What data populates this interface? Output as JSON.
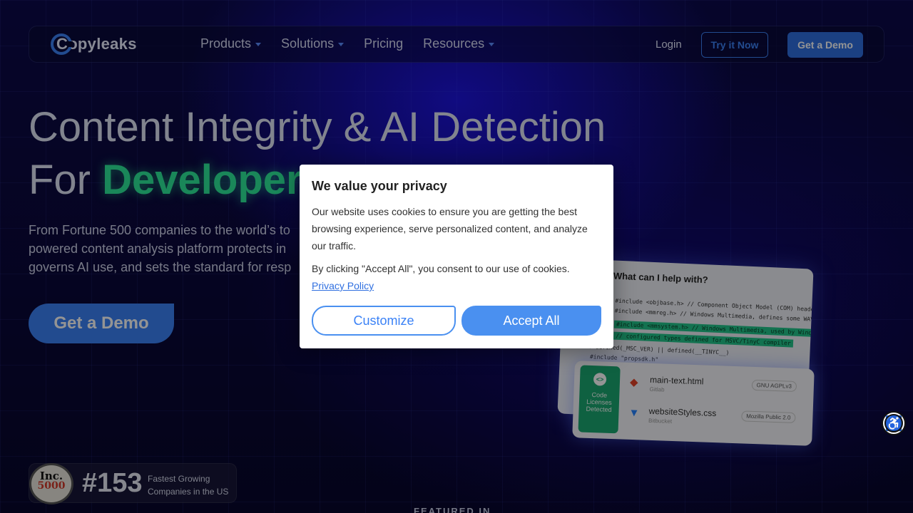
{
  "nav": {
    "logo_text": "Copyleaks",
    "links": [
      {
        "label": "Products",
        "has_dropdown": true
      },
      {
        "label": "Solutions",
        "has_dropdown": true
      },
      {
        "label": "Pricing",
        "has_dropdown": false
      },
      {
        "label": "Resources",
        "has_dropdown": true
      }
    ],
    "login": "Login",
    "try_it_now": "Try it Now",
    "get_demo": "Get a Demo"
  },
  "hero": {
    "title_line1": "Content Integrity & AI Detection",
    "title_line2_prefix": "For",
    "title_line2_accent": "Developers",
    "subtitle_lines": [
      "From Fortune 500 companies to the world’s to",
      "powered content analysis platform protects in",
      "governs AI use, and sets the standard for resp"
    ],
    "cta": "Get a Demo"
  },
  "illustration": {
    "chat_question": "What can I help with?",
    "code_lines": [
      "#include <objbase.h> // Component Object Model (COM) header",
      "#include <mmreg.h> // Windows Multimedia, defines some WAVE structs",
      "#include <mmsystem.h> // Windows Multimedia, used by Windows GDI,",
      "// configured types defined for MSVC/TinyC compiler",
      "#if defined(_MSC_VER) || defined(__TINYC__)",
      "#include \"propsdk.h\""
    ],
    "license_tag": "Code Licenses Detected",
    "files": [
      {
        "name": "main-text.html",
        "source": "Gitlab",
        "license": "GNU AGPLv3"
      },
      {
        "name": "websiteStyles.css",
        "source": "Bitbucket",
        "license": "Mozilla Public 2.0"
      }
    ]
  },
  "badge": {
    "seal_top": "Inc.",
    "seal_bottom": "5000",
    "rank": "#153",
    "text_line1": "Fastest Growing",
    "text_line2": "Companies in the US"
  },
  "featured": "FEATURED IN",
  "cookie_modal": {
    "title": "We value your privacy",
    "body": "Our website uses cookies to ensure you are getting the best browsing experience, serve personalized content, and analyze our traffic.",
    "consent_text": "By clicking \"Accept All\", you consent to our use of cookies.",
    "privacy_link": "Privacy Policy",
    "customize": "Customize",
    "accept_all": "Accept All"
  },
  "colors": {
    "accent_blue": "#3b82f6",
    "accent_green": "#2ee89a",
    "background": "#0a0838"
  },
  "icons": {
    "accessibility": "accessibility-icon"
  }
}
